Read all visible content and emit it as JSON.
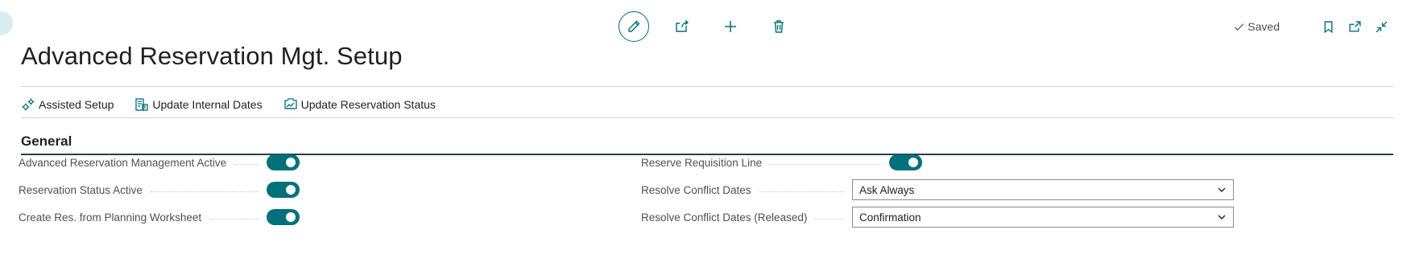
{
  "page": {
    "title": "Advanced Reservation Mgt. Setup"
  },
  "toolbar": {
    "edit_icon": "pencil-icon",
    "share_icon": "share-icon",
    "new_icon": "plus-icon",
    "delete_icon": "trash-icon"
  },
  "status": {
    "saved_label": "Saved"
  },
  "actions": [
    {
      "label": "Assisted Setup",
      "icon": "assisted-setup-icon"
    },
    {
      "label": "Update Internal Dates",
      "icon": "update-dates-icon"
    },
    {
      "label": "Update Reservation Status",
      "icon": "update-status-icon"
    }
  ],
  "general": {
    "title": "General",
    "left_fields": [
      {
        "label": "Advanced Reservation Management Active",
        "value": true
      },
      {
        "label": "Reservation Status Active",
        "value": true
      },
      {
        "label": "Create Res. from Planning Worksheet",
        "value": true
      }
    ],
    "right_fields": [
      {
        "label": "Reserve Requisition Line",
        "value": true
      },
      {
        "label": "Resolve Conflict Dates",
        "value": "Ask Always"
      },
      {
        "label": "Resolve Conflict Dates (Released)",
        "value": "Confirmation"
      }
    ]
  },
  "colors": {
    "accent": "#00707a",
    "section_rule": "#2b3d4e"
  }
}
